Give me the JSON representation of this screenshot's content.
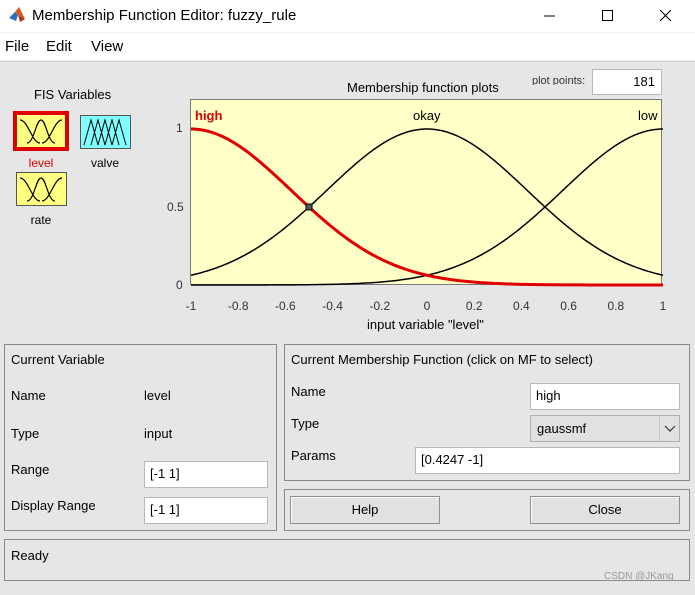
{
  "window": {
    "title": "Membership Function Editor: fuzzy_rule"
  },
  "menu": [
    "File",
    "Edit",
    "View"
  ],
  "fis": {
    "header": "FIS Variables",
    "vars": [
      {
        "name": "level",
        "kind": "input",
        "selected": true
      },
      {
        "name": "valve",
        "kind": "output",
        "selected": false
      },
      {
        "name": "rate",
        "kind": "input",
        "selected": false
      }
    ]
  },
  "plot": {
    "points_label": "plot points:",
    "points_value": "181",
    "title": "Membership function plots",
    "xlabel": "input variable \"level\"",
    "mf_labels": [
      "high",
      "okay",
      "low"
    ]
  },
  "chart_data": {
    "type": "line",
    "title": "Membership function plots",
    "xlabel": "input variable \"level\"",
    "ylabel": "",
    "xlim": [
      -1,
      1
    ],
    "ylim": [
      0,
      1
    ],
    "xticks": [
      "-1",
      "-0.8",
      "-0.6",
      "-0.4",
      "-0.2",
      "0",
      "0.2",
      "0.4",
      "0.6",
      "0.8",
      "1"
    ],
    "yticks": [
      "0",
      "0.5",
      "1"
    ],
    "series": [
      {
        "name": "high",
        "shape": "gaussmf",
        "sigma": 0.4247,
        "center": -1,
        "color": "#e00000",
        "selected": true
      },
      {
        "name": "okay",
        "shape": "gaussmf",
        "sigma": 0.4247,
        "center": 0,
        "color": "#000000",
        "selected": false
      },
      {
        "name": "low",
        "shape": "gaussmf",
        "sigma": 0.4247,
        "center": 1,
        "color": "#000000",
        "selected": false
      }
    ]
  },
  "current_variable": {
    "header": "Current Variable",
    "name_label": "Name",
    "name_value": "level",
    "type_label": "Type",
    "type_value": "input",
    "range_label": "Range",
    "range_value": "[-1 1]",
    "display_range_label": "Display Range",
    "display_range_value": "[-1 1]"
  },
  "current_mf": {
    "header": "Current Membership Function (click on MF to select)",
    "name_label": "Name",
    "name_value": "high",
    "type_label": "Type",
    "type_value": "gaussmf",
    "params_label": "Params",
    "params_value": "[0.4247 -1]"
  },
  "buttons": {
    "help": "Help",
    "close": "Close"
  },
  "status": "Ready",
  "watermark": "CSDN @JKang"
}
